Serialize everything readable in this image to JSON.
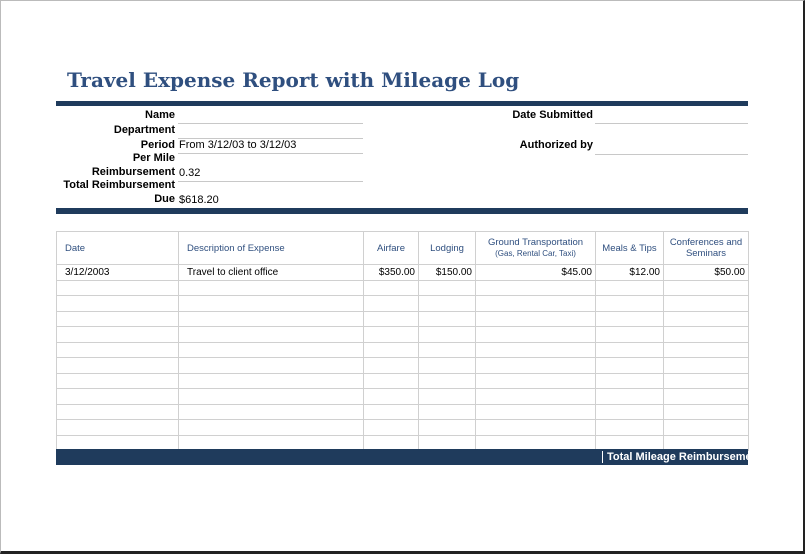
{
  "title": "Travel Expense Report with Mileage Log",
  "fields": {
    "name_label": "Name",
    "department_label": "Department",
    "period_label": "Period",
    "period_value": "From 3/12/03 to 3/12/03",
    "per_mile_label": "Per Mile",
    "reimbursement_label": "Reimbursement",
    "reimbursement_value": "0.32",
    "total_label": "Total Reimbursement",
    "due_label": "Due",
    "due_value": "$618.20",
    "date_submitted_label": "Date Submitted",
    "authorized_by_label": "Authorized by"
  },
  "table": {
    "headers": {
      "date": "Date",
      "description": "Description of Expense",
      "airfare": "Airfare",
      "lodging": "Lodging",
      "ground": "Ground Transportation",
      "ground_sub": "(Gas, Rental Car, Taxi)",
      "meals": "Meals & Tips",
      "conferences": "Conferences and Seminars"
    },
    "rows": [
      {
        "date": "3/12/2003",
        "description": "Travel to client office",
        "airfare": "$350.00",
        "lodging": "$150.00",
        "ground": "$45.00",
        "meals": "$12.00",
        "conferences": "$50.00"
      }
    ]
  },
  "footer": {
    "total_mileage_label": "Total Mileage Reimburseme"
  }
}
